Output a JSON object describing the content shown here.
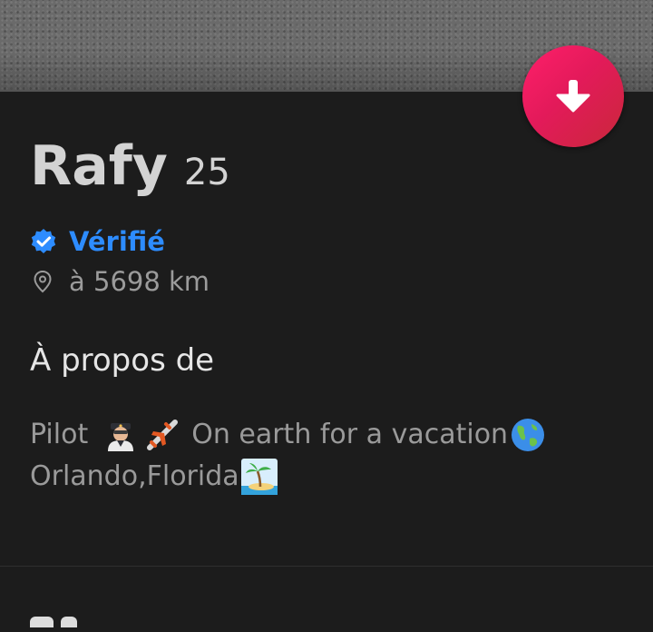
{
  "profile": {
    "name": "Rafy",
    "age": "25",
    "verified_label": "Vérifié",
    "distance": "à 5698 km"
  },
  "about": {
    "title": "À propos de",
    "bio_line1_a": "Pilot",
    "bio_line1_b": "On earth for a vacation",
    "bio_line2": "Orlando,Florida"
  },
  "icons": {
    "fab": "arrow-down-icon",
    "verified": "verified-badge-icon",
    "location": "location-pin-icon",
    "emoji_pilot": "pilot-emoji",
    "emoji_airplane": "airplane-emoji",
    "emoji_globe": "globe-emoji",
    "emoji_island": "desert-island-emoji"
  },
  "colors": {
    "background": "#1c1c1c",
    "accent_gradient_start": "#ff1f6a",
    "accent_gradient_end": "#c9283a",
    "verified_blue": "#2d8cff",
    "secondary_text": "#9b9b9b"
  }
}
